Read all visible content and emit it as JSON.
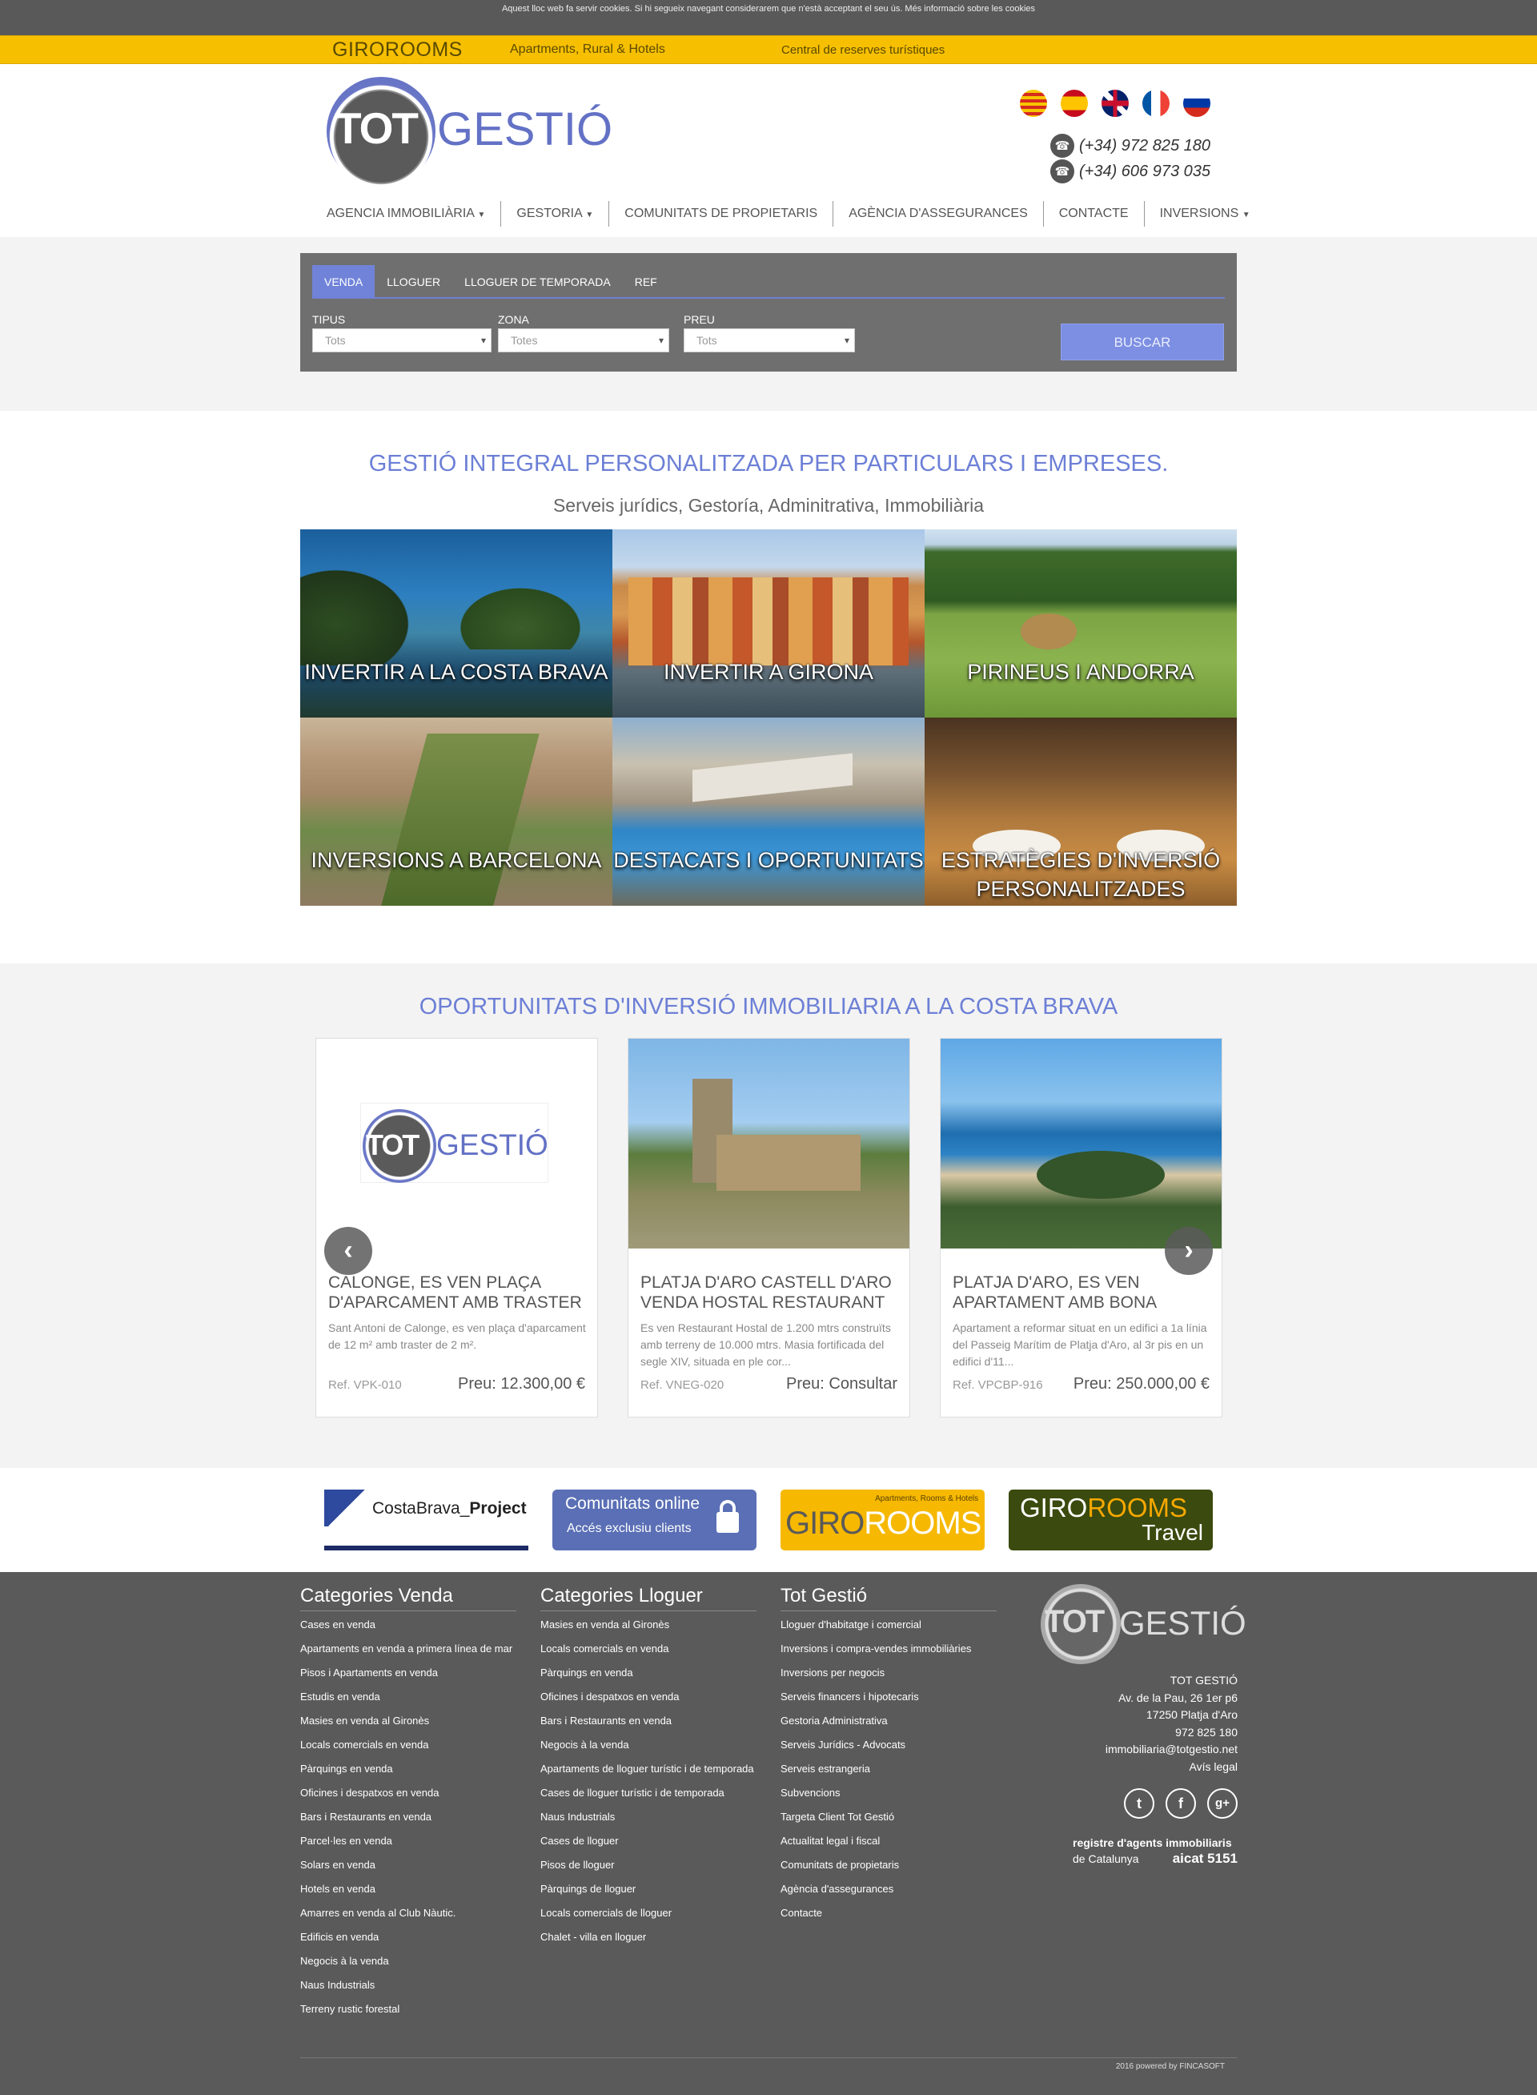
{
  "cookie": {
    "text": "Aquest lloc web fa servir cookies. Si hi segueix navegant considerarem que n'està acceptant el seu ús. Més informació sobre les cookies"
  },
  "topbar": {
    "brand": "GIROROOMS",
    "tagline": "Apartments, Rural & Hotels",
    "center": "Central de reserves turístiques"
  },
  "header": {
    "logo_tot": "TOT",
    "logo_gestio": "GESTIÓ",
    "phones": [
      "(+34) 972 825 180",
      "(+34) 606 973 035"
    ],
    "flags": [
      "catalan-flag-icon",
      "spanish-flag-icon",
      "uk-flag-icon",
      "french-flag-icon",
      "russian-flag-icon"
    ]
  },
  "nav": [
    {
      "label": "AGENCIA IMMOBILIÀRIA",
      "dropdown": true
    },
    {
      "label": "GESTORIA",
      "dropdown": true
    },
    {
      "label": "COMUNITATS DE PROPIETARIS",
      "dropdown": false
    },
    {
      "label": "AGÈNCIA D'ASSEGURANCES",
      "dropdown": false
    },
    {
      "label": "CONTACTE",
      "dropdown": false
    },
    {
      "label": "INVERSIONS",
      "dropdown": true
    }
  ],
  "search": {
    "tabs": [
      "VENDA",
      "LLOGUER",
      "LLOGUER DE TEMPORADA",
      "REF"
    ],
    "active_tab": "VENDA",
    "fields": [
      {
        "label": "TIPUS",
        "value": "Tots"
      },
      {
        "label": "ZONA",
        "value": "Totes"
      },
      {
        "label": "PREU",
        "value": "Tots"
      }
    ],
    "button": "BUSCAR"
  },
  "intro": {
    "title": "GESTIÓ INTEGRAL PERSONALITZADA PER PARTICULARS I EMPRESES.",
    "subtitle": "Serveis jurídics, Gestoría, Adminitrativa, Immobiliària",
    "tiles": [
      {
        "caption": "INVERTIR A LA COSTA BRAVA"
      },
      {
        "caption": "INVERTIR A GIRONA"
      },
      {
        "caption": "PIRINEUS I ANDORRA"
      },
      {
        "caption": "INVERSIONS A BARCELONA"
      },
      {
        "caption": "DESTACATS I OPORTUNITATS"
      },
      {
        "caption": "ESTRATÈGIES D'INVERSIÓ PERSONALITZADES"
      }
    ]
  },
  "opps": {
    "title": "OPORTUNITATS D'INVERSIÓ IMMOBILIARIA A LA COSTA BRAVA",
    "cards": [
      {
        "title": "CALONGE, ES VEN PLAÇA D'APARCAMENT AMB TRASTER",
        "desc": "Sant Antoni de Calonge, es ven plaça d'aparcament de 12 m² amb traster de 2 m².",
        "ref": "Ref. VPK-010",
        "price": "Preu: 12.300,00 €"
      },
      {
        "title": "PLATJA D'ARO CASTELL D'ARO VENDA HOSTAL RESTAURANT",
        "desc": "Es ven Restaurant Hostal de 1.200 mtrs construïts amb terreny de 10.000 mtrs. Masia fortificada del segle XIV, situada en ple cor...",
        "ref": "Ref. VNEG-020",
        "price": "Preu: Consultar"
      },
      {
        "title": "PLATJA D'ARO, ES VEN APARTAMENT AMB BONA",
        "desc": "Apartament a reformar situat en un edifici a 1a línia del Passeig Marítim de Platja d'Aro, al 3r pis en un edifici d'11...",
        "ref": "Ref. VPCBP-916",
        "price": "Preu: 250.000,00 €"
      }
    ]
  },
  "partners": {
    "costabrava": "CostaBrava_",
    "costabrava_bold": "Project",
    "comunitats_title": "Comunitats online",
    "comunitats_sub": "Accés exclusiu clients",
    "giro_small": "Apartments, Rooms & Hotels",
    "giro1": "GIRO",
    "giro2": "ROOMS",
    "travel": "Travel"
  },
  "footer": {
    "col1": {
      "title": "Categories Venda",
      "items": [
        "Cases en venda",
        "Apartaments en venda a primera línea de mar",
        "Pisos i Apartaments en venda",
        "Estudis en venda",
        "Masies en venda al Gironès",
        "Locals comercials en venda",
        "Pàrquings en venda",
        "Oficines i despatxos en venda",
        "Bars i Restaurants en venda",
        "Parcel·les en venda",
        "Solars en venda",
        "Hotels en venda",
        "Amarres en venda al Club Nàutic.",
        "Edificis en venda",
        "Negocis à la venda",
        "Naus Industrials",
        "Terreny rustic forestal"
      ]
    },
    "col2": {
      "title": "Categories Lloguer",
      "items": [
        "Masies en venda al Gironès",
        "Locals comercials en venda",
        "Pàrquings en venda",
        "Oficines i despatxos en venda",
        "Bars i Restaurants en venda",
        "Negocis à la venda",
        "Apartaments de lloguer turístic i de temporada",
        "Cases de lloguer turístic i de temporada",
        "Naus Industrials",
        "Cases de lloguer",
        "Pisos de lloguer",
        "Pàrquings de lloguer",
        "Locals comercials de lloguer",
        "Chalet - villa en lloguer"
      ]
    },
    "col3": {
      "title": "Tot Gestió",
      "items": [
        "Lloguer d'habitatge i comercial",
        "Inversions i compra-vendes immobiliàries",
        "Inversions per negocis",
        "Serveis financers i hipotecaris",
        "Gestoria Administrativa",
        "Serveis Jurídics - Advocats",
        "Serveis estrangeria",
        "Subvencions",
        "Targeta Client Tot Gestió",
        "Actualitat legal i fiscal",
        "Comunitats de propietaris",
        "Agència d'assegurances",
        "Contacte"
      ]
    },
    "address": [
      "TOT GESTIÓ",
      "Av. de la Pau, 26 1er p6",
      "17250 Platja d'Aro",
      "972 825 180",
      "immobiliaria@totgestio.net",
      "Avís legal"
    ],
    "social": [
      {
        "icon": "twitter-icon",
        "glyph": "t"
      },
      {
        "icon": "facebook-icon",
        "glyph": "f"
      },
      {
        "icon": "google-plus-icon",
        "glyph": "g+"
      }
    ],
    "aicat1": "registre d'agents immobiliaris",
    "aicat2": "de Catalunya",
    "aicat3": "aicat 5151",
    "copyright": "2016 powered by FINCASOFT"
  }
}
